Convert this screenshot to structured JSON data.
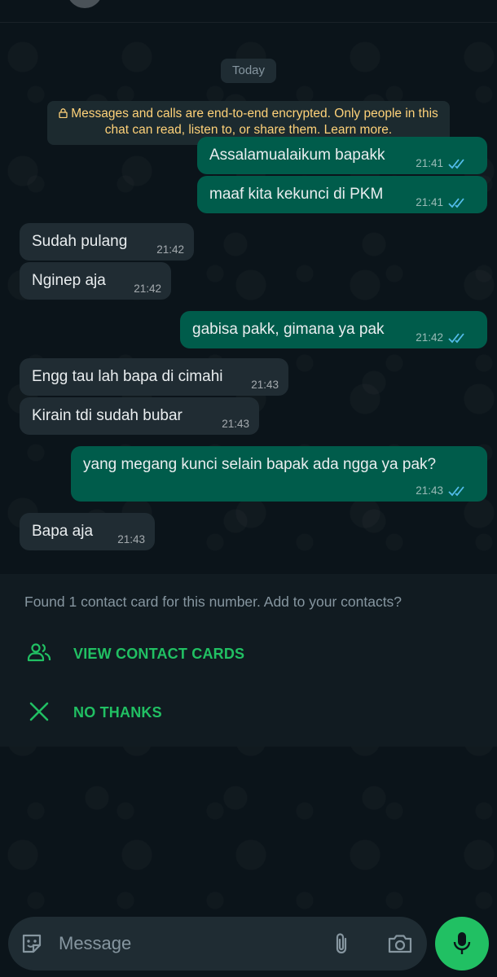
{
  "date_label": "Today",
  "encryption_notice": "Messages and calls are end-to-end encrypted. Only people in this chat can read, listen to, or share them. Learn more.",
  "messages": [
    {
      "direction": "out",
      "text": "Assalamualaikum bapakk",
      "time": "21:41",
      "status": "read"
    },
    {
      "direction": "out",
      "text": "maaf kita kekunci di PKM",
      "time": "21:41",
      "status": "read"
    },
    {
      "direction": "in",
      "text": "Sudah pulang",
      "time": "21:42"
    },
    {
      "direction": "in",
      "text": "Nginep aja",
      "time": "21:42"
    },
    {
      "direction": "out",
      "text": "gabisa pakk, gimana ya pak",
      "time": "21:42",
      "status": "read"
    },
    {
      "direction": "in",
      "text": "Engg tau lah bapa di cimahi",
      "time": "21:43"
    },
    {
      "direction": "in",
      "text": "Kirain tdi sudah bubar",
      "time": "21:43"
    },
    {
      "direction": "out",
      "text": "yang megang kunci selain bapak ada ngga ya pak?",
      "time": "21:43",
      "status": "read"
    },
    {
      "direction": "in",
      "text": "Bapa aja",
      "time": "21:43"
    }
  ],
  "contact_prompt": {
    "message": "Found 1 contact card for this number. Add to your contacts?",
    "view_label": "VIEW CONTACT CARDS",
    "dismiss_label": "NO THANKS"
  },
  "composer": {
    "placeholder": "Message"
  },
  "colors": {
    "outgoing_bubble": "#005c4b",
    "incoming_bubble": "#202c33",
    "accent": "#21c063",
    "read_ticks": "#53bdeb"
  },
  "icons": [
    "lock-icon",
    "double-check-icon",
    "contacts-icon",
    "close-icon",
    "emoji-icon",
    "attach-icon",
    "camera-icon",
    "mic-icon"
  ]
}
